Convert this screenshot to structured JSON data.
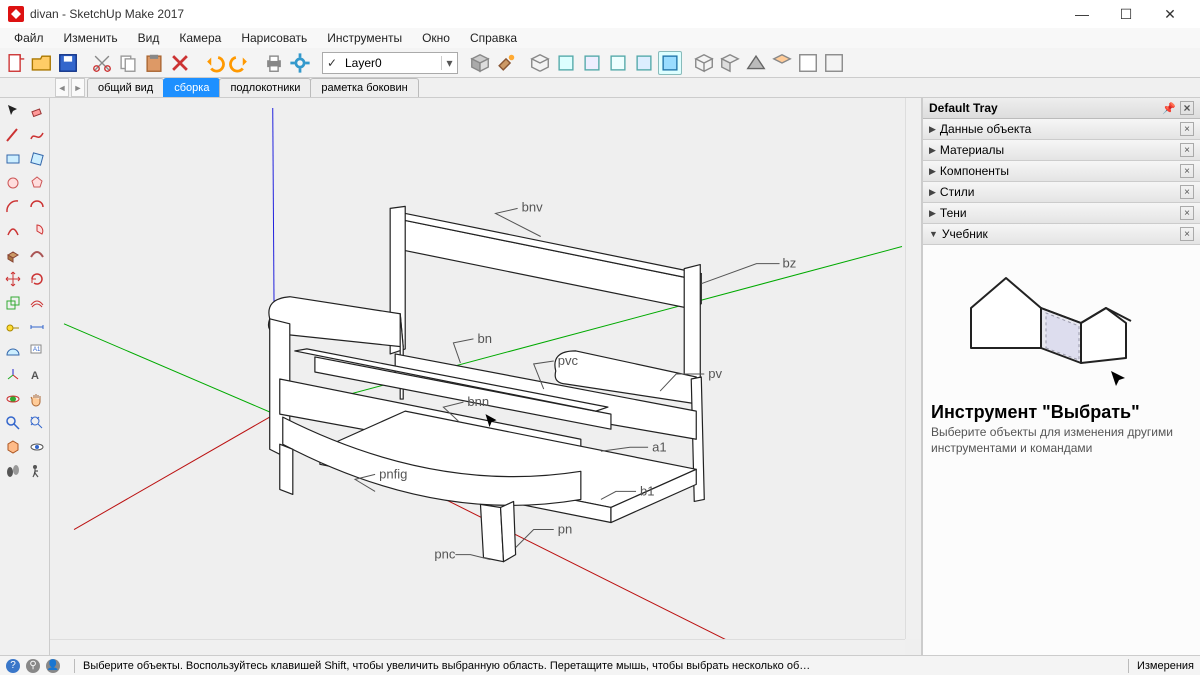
{
  "window": {
    "title": "divan - SketchUp Make 2017"
  },
  "menu": [
    "Файл",
    "Изменить",
    "Вид",
    "Камера",
    "Нарисовать",
    "Инструменты",
    "Окно",
    "Справка"
  ],
  "toolbar": {
    "layer_value": "Layer0"
  },
  "scenes": [
    {
      "label": "общий вид",
      "active": false
    },
    {
      "label": "сборка",
      "active": true
    },
    {
      "label": "подлокотники",
      "active": false
    },
    {
      "label": "раметка боковин",
      "active": false
    }
  ],
  "model_labels": {
    "bnv": "bnv",
    "bz": "bz",
    "bn": "bn",
    "pvc": "pvc",
    "pv": "pv",
    "bnn": "bnn",
    "a1": "a1",
    "b1": "b1",
    "pn": "pn",
    "pnc": "pnc",
    "pnfig": "pnfig"
  },
  "tray": {
    "title": "Default Tray",
    "panels": [
      {
        "label": "Данные объекта",
        "open": false
      },
      {
        "label": "Материалы",
        "open": false
      },
      {
        "label": "Компоненты",
        "open": false
      },
      {
        "label": "Стили",
        "open": false
      },
      {
        "label": "Тени",
        "open": false
      },
      {
        "label": "Учебник",
        "open": true
      }
    ],
    "instructor": {
      "title": "Инструмент \"Выбрать\"",
      "desc": "Выберите объекты для изменения другими инструментами и командами"
    }
  },
  "status": {
    "hint": "Выберите объекты. Воспользуйтесь клавишей Shift, чтобы увеличить выбранную область. Перетащите мышь, чтобы выбрать несколько об…",
    "measure_label": "Измерения"
  }
}
